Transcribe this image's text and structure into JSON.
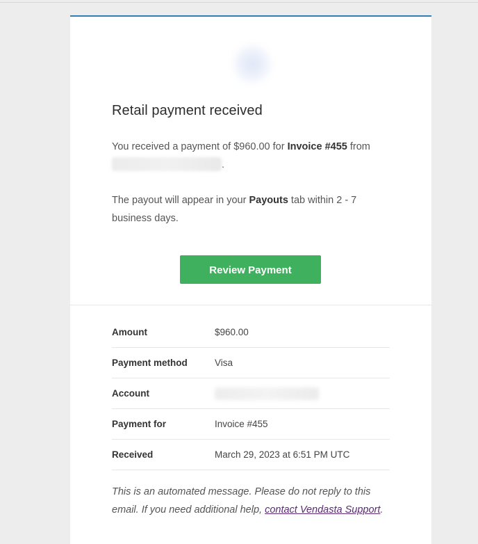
{
  "email": {
    "title": "Retail payment received",
    "intro": {
      "prefix": "You received a payment of $960.00 for ",
      "invoice": "Invoice #455",
      "middle": " from ",
      "suffix": "."
    },
    "payout": {
      "prefix": "The payout will appear in your ",
      "tab": "Payouts",
      "suffix": " tab within 2 - 7 business days."
    },
    "button_label": "Review Payment",
    "accent_color": "#3fb05e",
    "top_border_color": "#2f7fb4"
  },
  "details": [
    {
      "label": "Amount",
      "value": "$960.00"
    },
    {
      "label": "Payment method",
      "value": "Visa"
    },
    {
      "label": "Account",
      "value": ""
    },
    {
      "label": "Payment for",
      "value": "Invoice #455"
    },
    {
      "label": "Received",
      "value": "March 29, 2023 at 6:51 PM UTC"
    }
  ],
  "footer": {
    "text": "This is an automated message. Please do not reply to this email. If you need additional help, ",
    "link_text": "contact Vendasta Support",
    "suffix": "."
  }
}
